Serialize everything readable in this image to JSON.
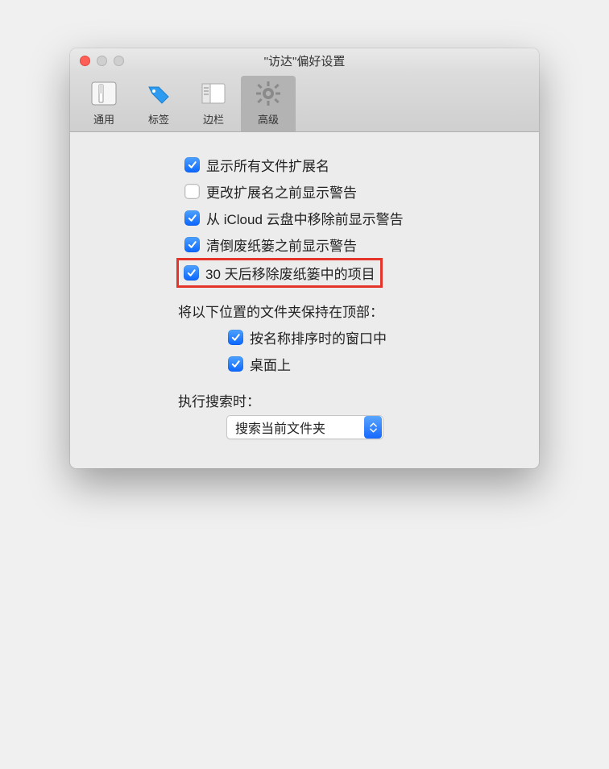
{
  "window": {
    "title": "\"访达\"偏好设置"
  },
  "toolbar": {
    "items": [
      {
        "label": "通用"
      },
      {
        "label": "标签"
      },
      {
        "label": "边栏"
      },
      {
        "label": "高级"
      }
    ]
  },
  "checkboxes": {
    "show_extensions": {
      "label": "显示所有文件扩展名",
      "checked": true
    },
    "warn_change_ext": {
      "label": "更改扩展名之前显示警告",
      "checked": false
    },
    "warn_remove_icloud": {
      "label": "从 iCloud 云盘中移除前显示警告",
      "checked": true
    },
    "warn_empty_trash": {
      "label": "清倒废纸篓之前显示警告",
      "checked": true
    },
    "remove_30_days": {
      "label": "30 天后移除废纸篓中的项目",
      "checked": true
    }
  },
  "folders_top": {
    "heading": "将以下位置的文件夹保持在顶部：",
    "in_windows": {
      "label": "按名称排序时的窗口中",
      "checked": true
    },
    "on_desktop": {
      "label": "桌面上",
      "checked": true
    }
  },
  "search": {
    "heading": "执行搜索时：",
    "selected": "搜索当前文件夹"
  }
}
